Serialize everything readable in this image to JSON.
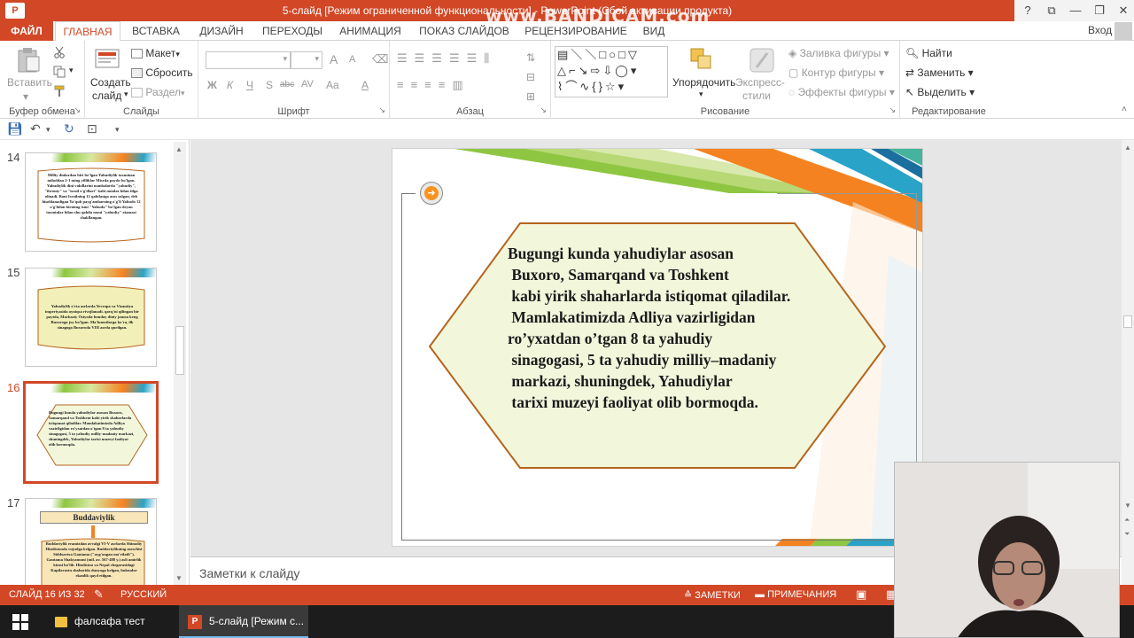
{
  "titlebar": {
    "title": "5-слайд [Режим ограниченной функциональности] - PowerPoint (Сбой активации продукта)",
    "watermark": "www.BANDICAM.com",
    "help": "?",
    "restore_ribbon": "⧉",
    "minimize": "—",
    "maximize": "❐",
    "close": "✕"
  },
  "tabs": {
    "file": "ФАЙЛ",
    "items": [
      "ГЛАВНАЯ",
      "ВСТАВКА",
      "ДИЗАЙН",
      "ПЕРЕХОДЫ",
      "АНИМАЦИЯ",
      "ПОКАЗ СЛАЙДОВ",
      "РЕЦЕНЗИРОВАНИЕ",
      "ВИД"
    ],
    "active": "ГЛАВНАЯ",
    "signin": "Вход"
  },
  "ribbon": {
    "clipboard": {
      "label": "Буфер обмена",
      "paste": "Вставить"
    },
    "slides": {
      "label": "Слайды",
      "new_slide_1": "Создать",
      "new_slide_2": "слайд",
      "layout": "Макет",
      "reset": "Сбросить",
      "section": "Раздел"
    },
    "font": {
      "label": "Шрифт",
      "bold": "Ж",
      "italic": "К",
      "underline": "Ч",
      "shadow": "S",
      "strike": "abc",
      "spacing": "AV",
      "case": "Aa",
      "grow": "A",
      "shrink": "A"
    },
    "paragraph": {
      "label": "Абзац"
    },
    "drawing": {
      "label": "Рисование",
      "arrange": "Упорядочить",
      "styles_1": "Экспресс-",
      "styles_2": "стили",
      "fill": "Заливка фигуры",
      "outline": "Контур фигуры",
      "effects": "Эффекты фигуры"
    },
    "editing": {
      "label": "Редактирование",
      "find": "Найти",
      "replace": "Заменить",
      "select": "Выделить"
    }
  },
  "thumbnails": [
    {
      "num": "14",
      "text": "Milliy dinlardan biri bo'lgan Yahudiylik taxminan miloddan 2-1 ming yilliklar Misrda paydo bo'lgan. Yahudiylik dini vakillarini manbalarda \"yahudiy\", \"ibroniy\" va \"isroil o'g'illari\" kabi nomlar bilan tilga olinadi. Bani Isroilning 12 qabilasiga asos solgan, deb hisoblanadigan Ya'qub payg'ambarning o'g'li Yahudo 12 o'g'lidan birining ismi \"Yahudo\" bo'lgan deyan taxminlar bilan shu qabila nomi \"yahudiy\" atamasi shakllangan."
    },
    {
      "num": "15",
      "text": "Yahudiylik o'rta asrlarda Yevropa va Vizantiya imperiyasida ayniqsa rivojlanadi. qavq'ni qilingan bir paytda, Markaziy Osiyoda bunday diniy jamoa keng Buxoroga joy bo'lgan. Ma'lumotlarga ko'ra, ilk sinagoga Buxoroda VIII asrda qurilgan."
    },
    {
      "num": "16",
      "text": "Bugungi kunda yahudiylar asosan Buxoro, Samarqand va Toshkent kabi yirik shaharlarda istiqomat qiladilar. Mamlakatimizda Adliya vazirligidan ro'yxatdan o'tgan 8 ta yahudiy sinagogasi, 5 ta yahudiy milliy-madaniy markazi, shuningdek, Yahudiylar tarixi muzeyi faoliyat olib bormoqda."
    },
    {
      "num": "17",
      "title": "Buddaviylik",
      "text": "Buddaviylik eramizdan avvalgi VI-V asrlarda Shimoliy Hindistonda vujudga kelgan. Buddaviylikning asoschisi Siddxartxa Gautama (\"uyg'ongan ma'rifatli\"). Gautama Shakyamuni (mil. av. 567-488 y.) asli amirlik kimsi bo'lib. Hindiston va Nepal chegarasidagi Kapilavastu shaharida dunyoga kelgan, hukmdor ekanlik qayd etilgan."
    }
  ],
  "selected_slide": "16",
  "slide": {
    "text": "Bugungi kunda yahudiylar asosan\n Buxoro, Samarqand va Toshkent\n kabi yirik shaharlarda istiqomat qiladilar.\n Mamlakatimizda Adliya vazirligidan\nro’yxatdan o’tgan 8 ta yahudiy\n sinagogasi, 5 ta yahudiy milliy–madaniy\n markazi, shuningdek, Yahudiylar\n tarixi muzeyi faoliyat olib bormoqda.",
    "hexagon_fill": "#f2f7dc",
    "hexagon_stroke": "#b5651d"
  },
  "notes": {
    "placeholder": "Заметки к слайду"
  },
  "status": {
    "slide_counter": "СЛАЙД 16 ИЗ 32",
    "language": "РУССКИЙ",
    "notes": "ЗАМЕТКИ",
    "comments": "ПРИМЕЧАНИЯ"
  },
  "taskbar": {
    "items": [
      "фалсафа тест",
      "5-слайд [Режим с..."
    ]
  },
  "colors": {
    "accent": "#d24726",
    "stripe_green": "#8ec641",
    "stripe_orange": "#f58220",
    "stripe_blue": "#29a3c7"
  }
}
